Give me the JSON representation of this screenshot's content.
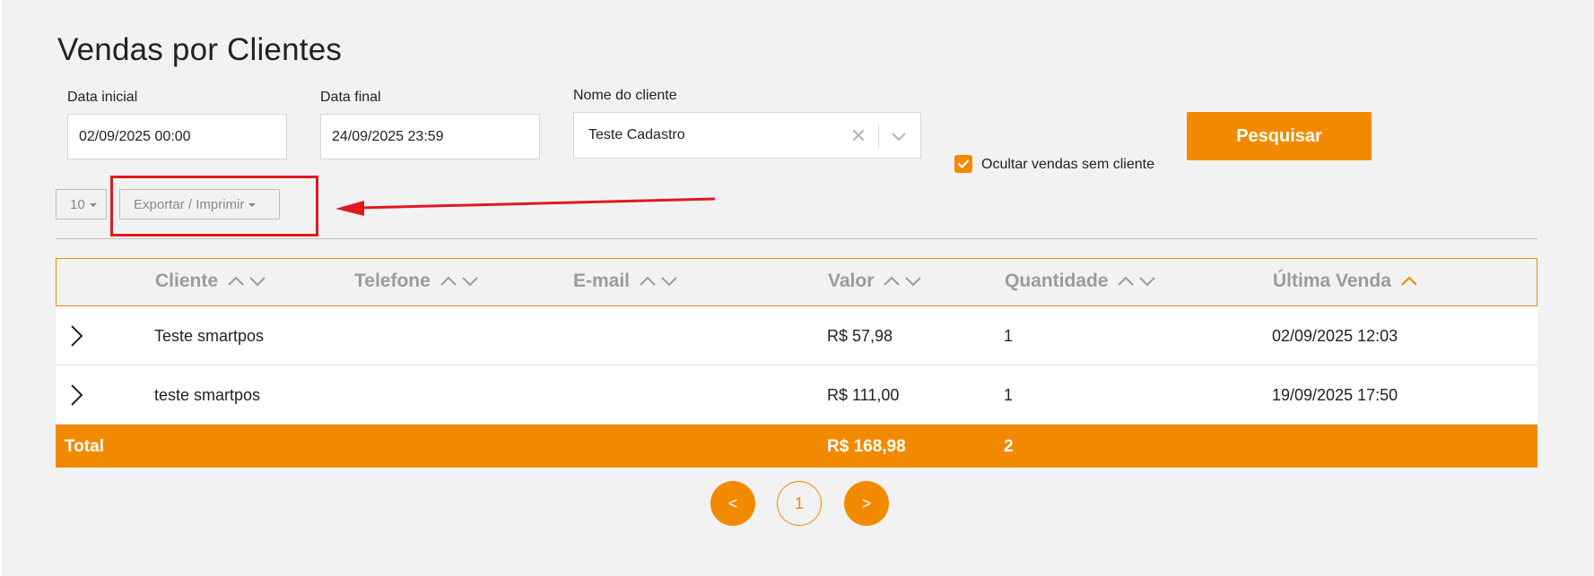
{
  "page": {
    "title": "Vendas por Clientes"
  },
  "filters": {
    "start_date_label": "Data inicial",
    "start_date_value": "02/09/2025 00:00",
    "end_date_label": "Data final",
    "end_date_value": "24/09/2025 23:59",
    "client_label": "Nome do cliente",
    "client_value": "Teste Cadastro",
    "search_label": "Pesquisar",
    "hide_no_client_label": "Ocultar vendas sem cliente",
    "hide_no_client_checked": true
  },
  "toolbar": {
    "page_size": "10",
    "export_label": "Exportar / Imprimir"
  },
  "table": {
    "headers": {
      "cliente": "Cliente",
      "telefone": "Telefone",
      "email": "E-mail",
      "valor": "Valor",
      "quantidade": "Quantidade",
      "ultima_venda": "Última Venda"
    },
    "rows": [
      {
        "cliente": "Teste smartpos",
        "telefone": "",
        "email": "",
        "valor": "R$ 57,98",
        "quantidade": "1",
        "ultima_venda": "02/09/2025 12:03"
      },
      {
        "cliente": "teste smartpos",
        "telefone": "",
        "email": "",
        "valor": "R$ 111,00",
        "quantidade": "1",
        "ultima_venda": "19/09/2025 17:50"
      }
    ],
    "total": {
      "label": "Total",
      "valor": "R$ 168,98",
      "quantidade": "2"
    }
  },
  "pagination": {
    "prev": "<",
    "current": "1",
    "next": ">"
  },
  "icons": {
    "clear": "close-icon",
    "dropdown": "chevron-down-icon",
    "check": "check-icon",
    "sort": "sort-arrows-icon",
    "sorted_asc": "chevron-up-icon",
    "expand": "chevron-right-icon"
  },
  "colors": {
    "accent": "#f28a00",
    "annotation": "#e0191f"
  }
}
